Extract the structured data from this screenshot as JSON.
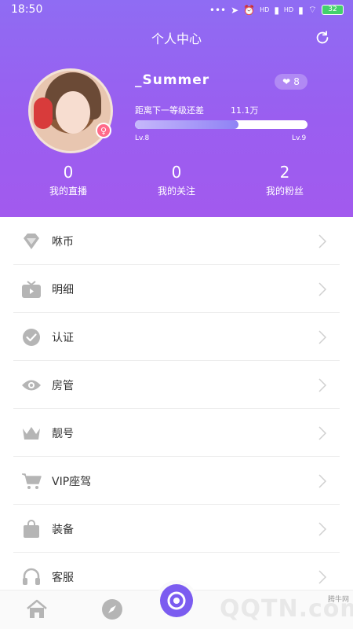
{
  "status_bar": {
    "time": "18:50",
    "signal_1": "HD",
    "signal_2": "HD",
    "battery": "32"
  },
  "header": {
    "title": "个人中心",
    "refresh_icon": "refresh-icon"
  },
  "profile": {
    "username": "_Summer",
    "likes": "8",
    "level_label": "距离下一等级还差",
    "level_remaining": "11.1万",
    "level_progress_fraction": 0.6,
    "current_level": "Lv.8",
    "next_level": "Lv.9"
  },
  "stats": [
    {
      "value": "0",
      "label": "我的直播"
    },
    {
      "value": "0",
      "label": "我的关注"
    },
    {
      "value": "2",
      "label": "我的粉丝"
    }
  ],
  "menu": {
    "items": [
      {
        "label": "咻币",
        "icon": "diamond-icon"
      },
      {
        "label": "明细",
        "icon": "tv-icon"
      },
      {
        "label": "认证",
        "icon": "check-circle-icon"
      },
      {
        "label": "房管",
        "icon": "eye-icon"
      },
      {
        "label": "靓号",
        "icon": "crown-icon"
      },
      {
        "label": "VIP座驾",
        "icon": "cart-icon"
      },
      {
        "label": "装备",
        "icon": "bag-icon"
      },
      {
        "label": "客服",
        "icon": "headset-icon"
      }
    ]
  },
  "bottom_nav": {
    "items": [
      "home-icon",
      "compass-icon",
      "live-camera-icon"
    ]
  },
  "watermark": {
    "text": "QQTN.com",
    "small": "腾牛网"
  },
  "colors": {
    "header_top": "#8f6cf3",
    "header_bottom": "#a25aee",
    "accent": "#7b5cf0",
    "icon_gray": "#b5b5b5"
  }
}
